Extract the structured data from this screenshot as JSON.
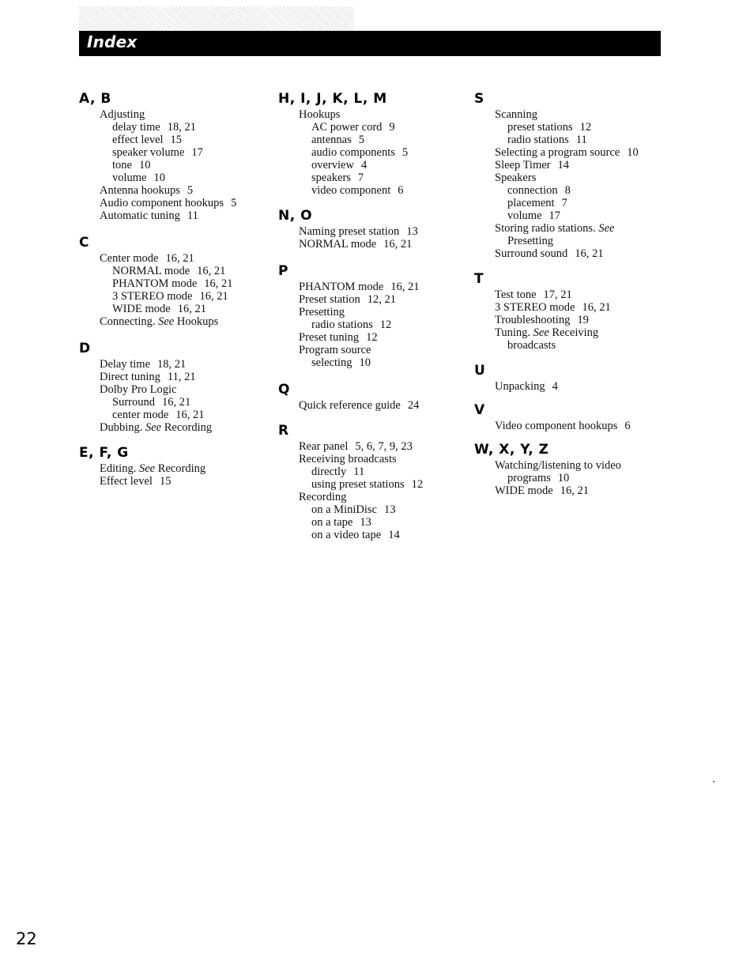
{
  "header": {
    "title": "Index"
  },
  "page_number": "22",
  "columns": [
    {
      "sections": [
        {
          "letters": "A, B",
          "entries": [
            {
              "text": "Adjusting",
              "pages": "",
              "level": 0
            },
            {
              "text": "delay time",
              "pages": "18, 21",
              "level": 1
            },
            {
              "text": "effect level",
              "pages": "15",
              "level": 1
            },
            {
              "text": "speaker volume",
              "pages": "17",
              "level": 1
            },
            {
              "text": "tone",
              "pages": "10",
              "level": 1
            },
            {
              "text": "volume",
              "pages": "10",
              "level": 1
            },
            {
              "text": "Antenna hookups",
              "pages": "5",
              "level": 0
            },
            {
              "text": "Audio component hookups",
              "pages": "5",
              "level": 0
            },
            {
              "text": "Automatic tuning",
              "pages": "11",
              "level": 0
            }
          ]
        },
        {
          "letters": "C",
          "entries": [
            {
              "text": "Center mode",
              "pages": "16, 21",
              "level": 0
            },
            {
              "text": "NORMAL mode",
              "pages": "16, 21",
              "level": 1
            },
            {
              "text": "PHANTOM mode",
              "pages": "16, 21",
              "level": 1
            },
            {
              "text": "3 STEREO mode",
              "pages": "16, 21",
              "level": 1
            },
            {
              "text": "WIDE mode",
              "pages": "16, 21",
              "level": 1
            },
            {
              "text": "Connecting.",
              "see": "See",
              "see_target": "Hookups",
              "level": 0
            }
          ]
        },
        {
          "letters": "D",
          "entries": [
            {
              "text": "Delay time",
              "pages": "18, 21",
              "level": 0
            },
            {
              "text": "Direct tuning",
              "pages": "11, 21",
              "level": 0
            },
            {
              "text": "Dolby Pro Logic",
              "pages": "",
              "level": 0
            },
            {
              "text": "Surround",
              "pages": "16, 21",
              "level": 1
            },
            {
              "text": "center mode",
              "pages": "16, 21",
              "level": 1
            },
            {
              "text": "Dubbing.",
              "see": "See",
              "see_target": "Recording",
              "level": 0
            }
          ]
        },
        {
          "letters": "E, F, G",
          "entries": [
            {
              "text": "Editing.",
              "see": "See",
              "see_target": "Recording",
              "level": 0
            },
            {
              "text": "Effect level",
              "pages": "15",
              "level": 0
            }
          ]
        }
      ]
    },
    {
      "sections": [
        {
          "letters": "H, I, J, K, L, M",
          "entries": [
            {
              "text": "Hookups",
              "pages": "",
              "level": 0
            },
            {
              "text": "AC power cord",
              "pages": "9",
              "level": 1
            },
            {
              "text": "antennas",
              "pages": "5",
              "level": 1
            },
            {
              "text": "audio components",
              "pages": "5",
              "level": 1
            },
            {
              "text": "overview",
              "pages": "4",
              "level": 1
            },
            {
              "text": "speakers",
              "pages": "7",
              "level": 1
            },
            {
              "text": "video component",
              "pages": "6",
              "level": 1
            }
          ]
        },
        {
          "letters": "N, O",
          "entries": [
            {
              "text": "Naming preset station",
              "pages": "13",
              "level": 0
            },
            {
              "text": "NORMAL mode",
              "pages": "16, 21",
              "level": 0
            }
          ]
        },
        {
          "letters": "P",
          "entries": [
            {
              "text": "PHANTOM mode",
              "pages": "16, 21",
              "level": 0
            },
            {
              "text": "Preset station",
              "pages": "12, 21",
              "level": 0
            },
            {
              "text": "Presetting",
              "pages": "",
              "level": 0
            },
            {
              "text": "radio stations",
              "pages": "12",
              "level": 1
            },
            {
              "text": "Preset tuning",
              "pages": "12",
              "level": 0
            },
            {
              "text": "Program source",
              "pages": "",
              "level": 0
            },
            {
              "text": "selecting",
              "pages": "10",
              "level": 1
            }
          ]
        },
        {
          "letters": "Q",
          "entries": [
            {
              "text": "Quick reference guide",
              "pages": "24",
              "level": 0
            }
          ]
        },
        {
          "letters": "R",
          "entries": [
            {
              "text": "Rear panel",
              "pages": "5, 6, 7, 9, 23",
              "level": 0
            },
            {
              "text": "Receiving broadcasts",
              "pages": "",
              "level": 0
            },
            {
              "text": "directly",
              "pages": "11",
              "level": 1
            },
            {
              "text": "using preset stations",
              "pages": "12",
              "level": 1
            },
            {
              "text": "Recording",
              "pages": "",
              "level": 0
            },
            {
              "text": "on a MiniDisc",
              "pages": "13",
              "level": 1
            },
            {
              "text": "on a tape",
              "pages": "13",
              "level": 1
            },
            {
              "text": "on a video tape",
              "pages": "14",
              "level": 1
            }
          ]
        }
      ]
    },
    {
      "sections": [
        {
          "letters": "S",
          "entries": [
            {
              "text": "Scanning",
              "pages": "",
              "level": 0
            },
            {
              "text": "preset stations",
              "pages": "12",
              "level": 1
            },
            {
              "text": "radio stations",
              "pages": "11",
              "level": 1
            },
            {
              "text": "Selecting a program source",
              "pages": "10",
              "level": 0
            },
            {
              "text": "Sleep Timer",
              "pages": "14",
              "level": 0
            },
            {
              "text": "Speakers",
              "pages": "",
              "level": 0
            },
            {
              "text": "connection",
              "pages": "8",
              "level": 1
            },
            {
              "text": "placement",
              "pages": "7",
              "level": 1
            },
            {
              "text": "volume",
              "pages": "17",
              "level": 1
            },
            {
              "text": "Storing radio stations.",
              "see": "See",
              "see_target": "",
              "level": 0
            },
            {
              "text": "Presetting",
              "pages": "",
              "level": 1
            },
            {
              "text": "Surround sound",
              "pages": "16, 21",
              "level": 0
            }
          ]
        },
        {
          "letters": "T",
          "entries": [
            {
              "text": "Test tone",
              "pages": "17, 21",
              "level": 0
            },
            {
              "text": "3 STEREO mode",
              "pages": "16, 21",
              "level": 0
            },
            {
              "text": "Troubleshooting",
              "pages": "19",
              "level": 0
            },
            {
              "text": "Tuning.",
              "see": "See",
              "see_target": "Receiving",
              "level": 0
            },
            {
              "text": "broadcasts",
              "pages": "",
              "level": 1
            }
          ]
        },
        {
          "letters": "U",
          "entries": [
            {
              "text": "Unpacking",
              "pages": "4",
              "level": 0
            }
          ]
        },
        {
          "letters": "V",
          "entries": [
            {
              "text": "Video component hookups",
              "pages": "6",
              "level": 0
            }
          ]
        },
        {
          "letters": "W, X, Y, Z",
          "entries": [
            {
              "text": "Watching/listening to video",
              "pages": "",
              "level": 0
            },
            {
              "text": "programs",
              "pages": "10",
              "level": 1
            },
            {
              "text": "WIDE mode",
              "pages": "16, 21",
              "level": 0
            }
          ]
        }
      ]
    }
  ]
}
